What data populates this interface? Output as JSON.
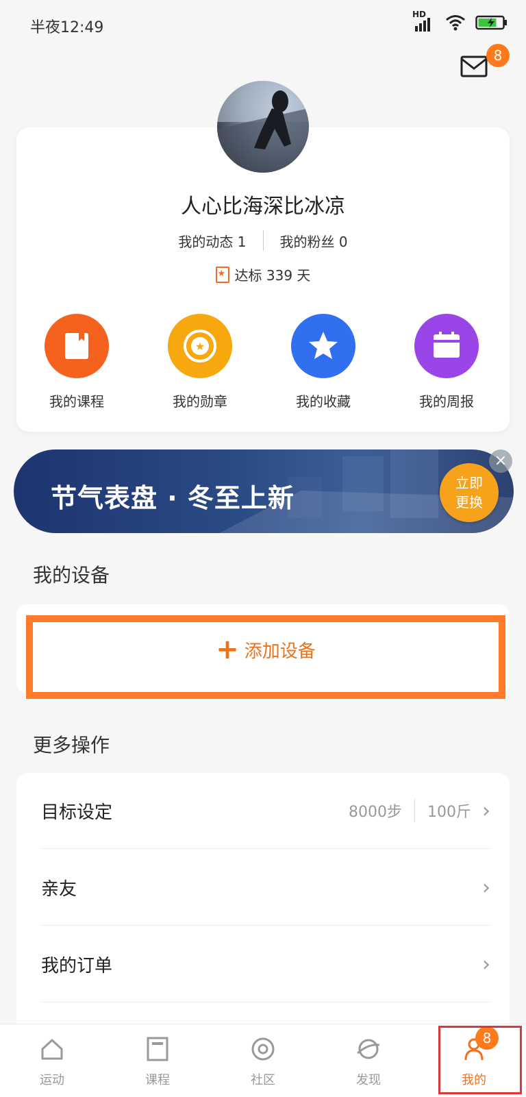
{
  "status_bar": {
    "time": "半夜12:49",
    "network": "HD"
  },
  "header": {
    "mail_badge": "8"
  },
  "profile": {
    "nickname": "人心比海深比冰凉",
    "posts_label": "我的动态 1",
    "fans_label": "我的粉丝 0",
    "streak_label": "达标 339 天"
  },
  "features": [
    {
      "label": "我的课程",
      "icon": "course-book-icon",
      "color": "#f5621e"
    },
    {
      "label": "我的勋章",
      "icon": "medal-icon",
      "color": "#f7a80f"
    },
    {
      "label": "我的收藏",
      "icon": "star-icon",
      "color": "#2f6ff0"
    },
    {
      "label": "我的周报",
      "icon": "calendar-icon",
      "color": "#9a45e8"
    }
  ],
  "banner": {
    "title": "节气表盘 · 冬至上新",
    "button_line1": "立即",
    "button_line2": "更换",
    "close": "×"
  },
  "devices": {
    "section_title": "我的设备",
    "add_label": "添加设备",
    "add_icon": "+"
  },
  "more_ops": {
    "section_title": "更多操作",
    "rows": [
      {
        "label": "目标设定",
        "steps": "8000步",
        "weight": "100斤"
      },
      {
        "label": "亲友"
      },
      {
        "label": "我的订单"
      }
    ],
    "chevron": "›"
  },
  "bottom_nav": {
    "items": [
      {
        "label": "运动",
        "icon": "home-icon"
      },
      {
        "label": "课程",
        "icon": "course-icon"
      },
      {
        "label": "社区",
        "icon": "community-icon"
      },
      {
        "label": "发现",
        "icon": "planet-icon"
      },
      {
        "label": "我的",
        "icon": "profile-icon"
      }
    ],
    "active": "我的",
    "badge": "8"
  },
  "colors": {
    "accent": "#f07020",
    "badge": "#ff7a1a",
    "highlight": "#ff7a2a"
  }
}
